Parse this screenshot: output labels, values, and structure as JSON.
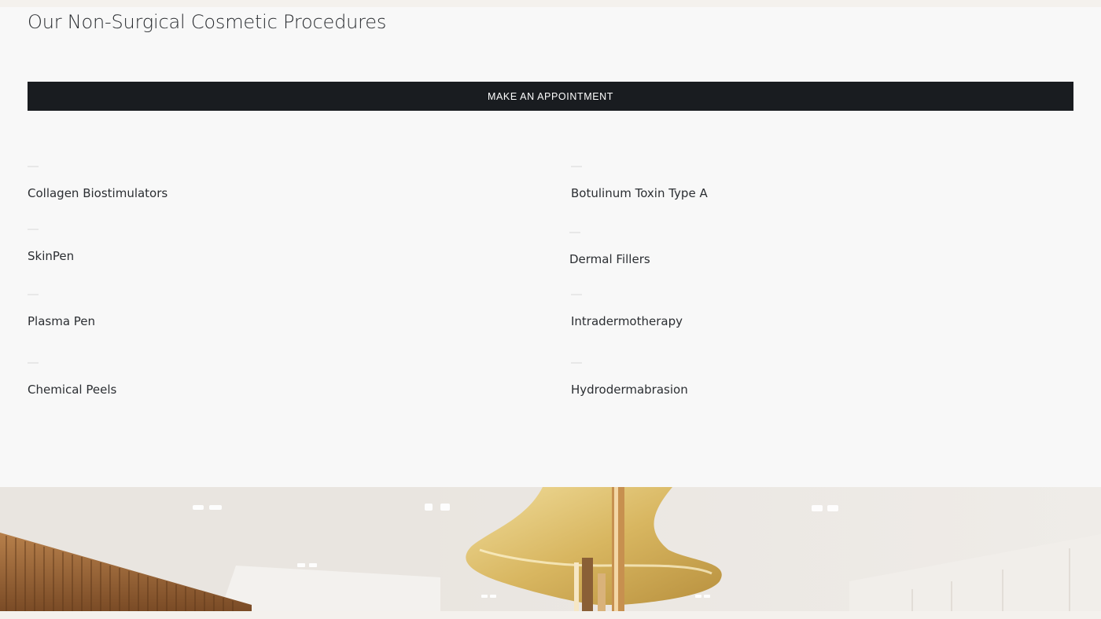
{
  "section": {
    "title": "Our Non-Surgical Cosmetic Procedures",
    "cta_label": "MAKE AN APPOINTMENT"
  },
  "procedures": {
    "left": [
      "Collagen Biostimulators",
      "SkinPen",
      "Plasma Pen",
      "Chemical Peels"
    ],
    "right": [
      "Botulinum Toxin Type A",
      "Dermal Fillers",
      "Intradermotherapy",
      "Hydrodermabrasion"
    ]
  },
  "colors": {
    "page_bg": "#f8f8f8",
    "button_bg": "#191c20",
    "button_text": "#ffffff",
    "text": "#2b2e32",
    "accent_gold": "#c9a24e"
  }
}
